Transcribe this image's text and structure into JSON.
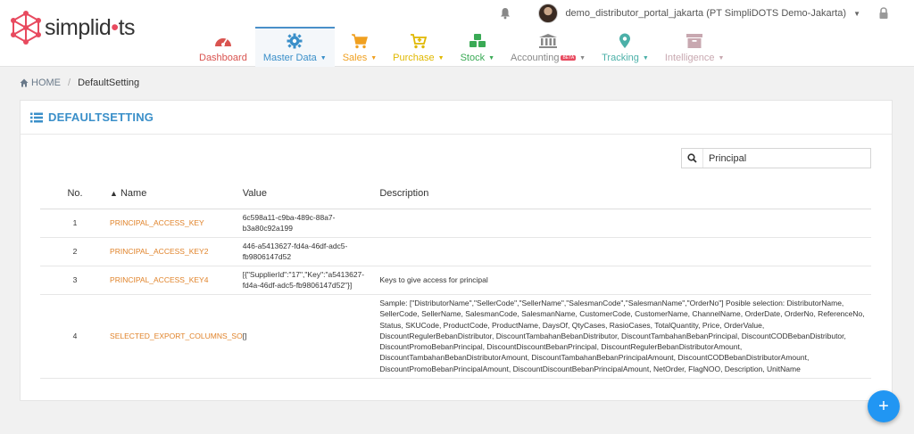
{
  "brand": {
    "name_prefix": "simplid",
    "name_dot": "•",
    "name_suffix": "ts"
  },
  "user": {
    "name": "demo_distributor_portal_jakarta (PT SimpliDOTS Demo-Jakarta)"
  },
  "nav": [
    {
      "label": "Dashboard",
      "color": "#d9534f",
      "icon": "speedometer-icon",
      "dropdown": false,
      "active": false
    },
    {
      "label": "Master Data",
      "color": "#3a8fc9",
      "icon": "gear-icon",
      "dropdown": true,
      "active": true
    },
    {
      "label": "Sales",
      "color": "#f0a020",
      "icon": "cart-icon",
      "dropdown": true,
      "active": false
    },
    {
      "label": "Purchase",
      "color": "#e0b800",
      "icon": "cart-plus-icon",
      "dropdown": true,
      "active": false
    },
    {
      "label": "Stock",
      "color": "#3aaa55",
      "icon": "cubes-icon",
      "dropdown": true,
      "active": false
    },
    {
      "label": "Accounting",
      "color": "#888888",
      "icon": "bank-icon",
      "dropdown": true,
      "active": false,
      "badge": "BETA"
    },
    {
      "label": "Tracking",
      "color": "#4bb0a8",
      "icon": "map-marker-icon",
      "dropdown": true,
      "active": false
    },
    {
      "label": "Intelligence",
      "color": "#c8a8b0",
      "icon": "archive-icon",
      "dropdown": true,
      "active": false
    }
  ],
  "breadcrumb": {
    "home": "HOME",
    "current": "DefaultSetting"
  },
  "panel": {
    "title": "DEFAULTSETTING"
  },
  "search": {
    "value": "Principal"
  },
  "table": {
    "headers": {
      "no": "No.",
      "name": "Name",
      "value": "Value",
      "description": "Description"
    },
    "rows": [
      {
        "no": "1",
        "name": "PRINCIPAL_ACCESS_KEY",
        "value": "6c598a11-c9ba-489c-88a7-b3a80c92a199",
        "description": ""
      },
      {
        "no": "2",
        "name": "PRINCIPAL_ACCESS_KEY2",
        "value": "446-a5413627-fd4a-46df-adc5-fb9806147d52",
        "description": ""
      },
      {
        "no": "3",
        "name": "PRINCIPAL_ACCESS_KEY4",
        "value": "[{\"SupplierId\":\"17\",\"Key\":\"a5413627-fd4a-46df-adc5-fb9806147d52\"}]",
        "description": "Keys to give access for principal"
      },
      {
        "no": "4",
        "name": "SELECTED_EXPORT_COLUMNS_SO",
        "value": "[]",
        "description": "Sample: [\"DistributorName\",\"SellerCode\",\"SellerName\",\"SalesmanCode\",\"SalesmanName\",\"OrderNo\"] Posible selection: DistributorName, SellerCode, SellerName, SalesmanCode, SalesmanName, CustomerCode, CustomerName, ChannelName, OrderDate, OrderNo, ReferenceNo, Status, SKUCode, ProductCode, ProductName, DaysOf, QtyCases, RasioCases, TotalQuantity, Price, OrderValue, DiscountRegulerBebanDistributor, DiscountTambahanBebanDistributor, DiscountTambahanBebanPrincipal, DiscountCODBebanDistributor, DiscountPromoBebanPrincipal, DiscountDiscountBebanPrincipal, DiscountRegulerBebanDistributorAmount, DiscountTambahanBebanDistributorAmount, DiscountTambahanBebanPrincipalAmount, DiscountCODBebanDistributorAmount, DiscountPromoBebanPrincipalAmount, DiscountDiscountBebanPrincipalAmount, NetOrder, FlagNOO, Description, UnitName"
      }
    ]
  },
  "fab": {
    "label": "+"
  }
}
